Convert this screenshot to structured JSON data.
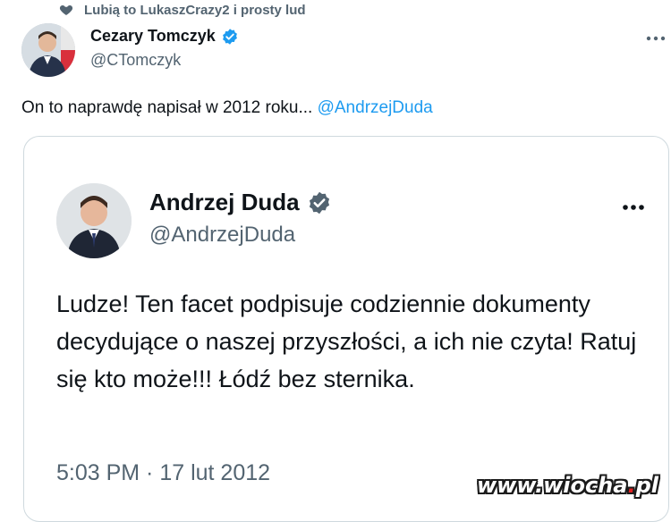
{
  "social_context": {
    "icon": "heart-icon",
    "text": "Lubią to LukaszCrazy2 i prosty lud"
  },
  "author": {
    "name": "Cezary Tomczyk",
    "handle": "@CTomczyk",
    "verified": true
  },
  "tweet": {
    "text": "On to naprawdę napisał w 2012 roku... ",
    "mention": "@AndrzejDuda"
  },
  "quoted": {
    "name": "Andrzej Duda",
    "handle": "@AndrzejDuda",
    "verified": true,
    "text": "Ludze! Ten facet podpisuje codziennie dokumenty decydujące o naszej przyszłości, a ich nie czyta! Ratuj się kto może!!! Łódź bez sternika.",
    "timestamp": "5:03 PM · 17 lut 2012"
  },
  "watermark": {
    "prefix": "www.wiocha",
    "dot": ".",
    "suffix": "pl"
  },
  "colors": {
    "accent": "#1d9bf0",
    "secondary_text": "#536471",
    "border": "#cfd9de"
  }
}
